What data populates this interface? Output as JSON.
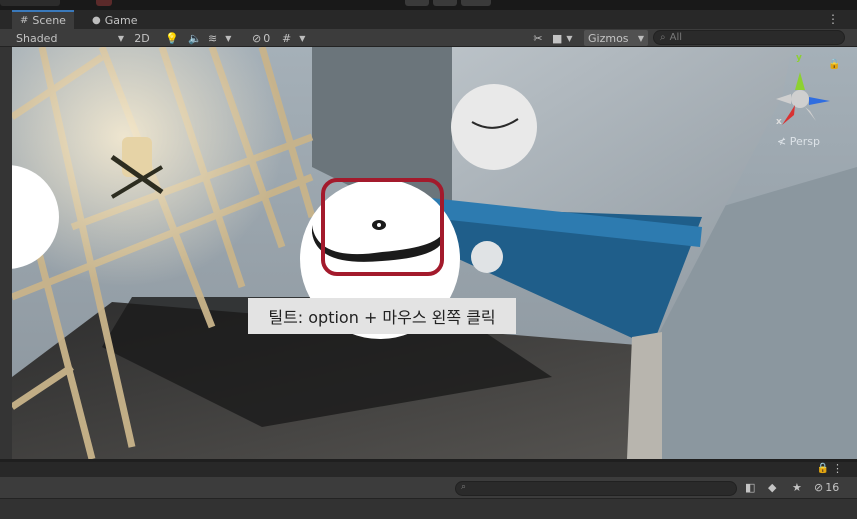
{
  "tabs": [
    {
      "label": "Scene",
      "icon": "grid-icon",
      "active": true
    },
    {
      "label": "Game",
      "icon": "gamepad-icon",
      "active": false
    }
  ],
  "toolbar": {
    "shading_mode": "Shaded",
    "mode_2d": "2D",
    "hidden_count": "0",
    "gizmos_label": "Gizmos",
    "search_placeholder": "All"
  },
  "gizmo": {
    "projection_label": "Persp",
    "axis_x": "x",
    "axis_y": "y"
  },
  "caption": "틸트: option + 마우스 왼쪽 클릭",
  "bottom_panel": {
    "hidden_count": "16"
  },
  "colors": {
    "highlight_ring": "#a31a2c",
    "tab_accent": "#3a79bb",
    "axis_x": "#d93232",
    "axis_y": "#8dd131",
    "axis_z": "#2f6de0"
  }
}
